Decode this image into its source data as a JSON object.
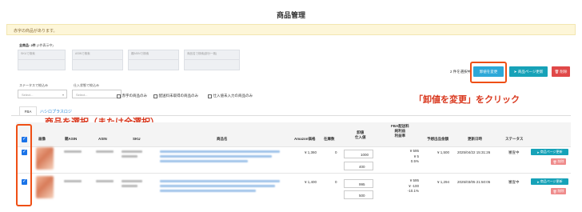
{
  "page_title": "商品管理",
  "alert_text": "赤字の商品があります。",
  "filters": {
    "summary_count": "全商品: 2件",
    "summary_note": "(2件表示中)",
    "sku_placeholder": "SKUで検索",
    "asin_placeholder": "ASINで検索",
    "parent_asin_placeholder": "親ASINで検索",
    "product_name_placeholder": "商品名で検索(部分一致)",
    "status_label": "ステータスで絞込み",
    "shipping_label": "仕入状態で絞込み",
    "select_placeholder": "Select...",
    "checkbox_deficit": "赤字の商品のみ",
    "checkbox_no_shipping": "配送料未取得の商品のみ",
    "checkbox_no_cost": "仕入値未入力の商品のみ"
  },
  "toolbar": {
    "selected_count": "2 件を選択中",
    "change_wholesale_button": "卸値を変更",
    "update_product_page_button": "商品ページ更新",
    "delete_button": "削除"
  },
  "tabs": [
    "FBA",
    "ハシロプラスロジ"
  ],
  "annotations": {
    "change_price_instruction": "「卸値を変更」をクリック",
    "select_products_instruction": "商品を選択（または全選択）"
  },
  "table": {
    "headers": {
      "image": "画像",
      "parent_asin": "親ASIN",
      "asin": "ASIN",
      "sku": "SKU",
      "product_name": "商品名",
      "amazon_price": "Amazon価格",
      "stock": "在庫数",
      "wholesale_1": "卸値",
      "wholesale_2": "仕入値",
      "fba_1": "FBA配送料",
      "fba_2": "純利益",
      "fba_3": "利益率",
      "forecast_sales": "予想出品金額",
      "updated_at": "更新日時",
      "status": "ステータス"
    },
    "rows": [
      {
        "amazon_price": "¥ 1,360",
        "stock": "0",
        "wholesale": "1000",
        "cost": "400",
        "fba_fee": "¥ 595",
        "net_profit": "¥ 5",
        "margin": "0.5%",
        "forecast": "¥ 1,500",
        "updated": "2025/04/22 15:31:26",
        "status": "審査中",
        "update_button": "商品ページ更新",
        "delete_button": "削除"
      },
      {
        "amazon_price": "¥ 1,400",
        "stock": "0",
        "wholesale": "995",
        "cost": "500",
        "fba_fee": "¥ 595",
        "net_profit": "¥ -100",
        "margin": "-10.1%",
        "forecast": "¥ 1,294",
        "updated": "2025/03/05 21:50:05",
        "status": "審査中",
        "update_button": "商品ページ更新",
        "delete_button": "削除"
      }
    ]
  },
  "colors": {
    "primary": "#2da8d8",
    "teal": "#17a2b8",
    "danger": "#e04848",
    "annotation": "#d9381e",
    "checkbox": "#1a73e8"
  }
}
